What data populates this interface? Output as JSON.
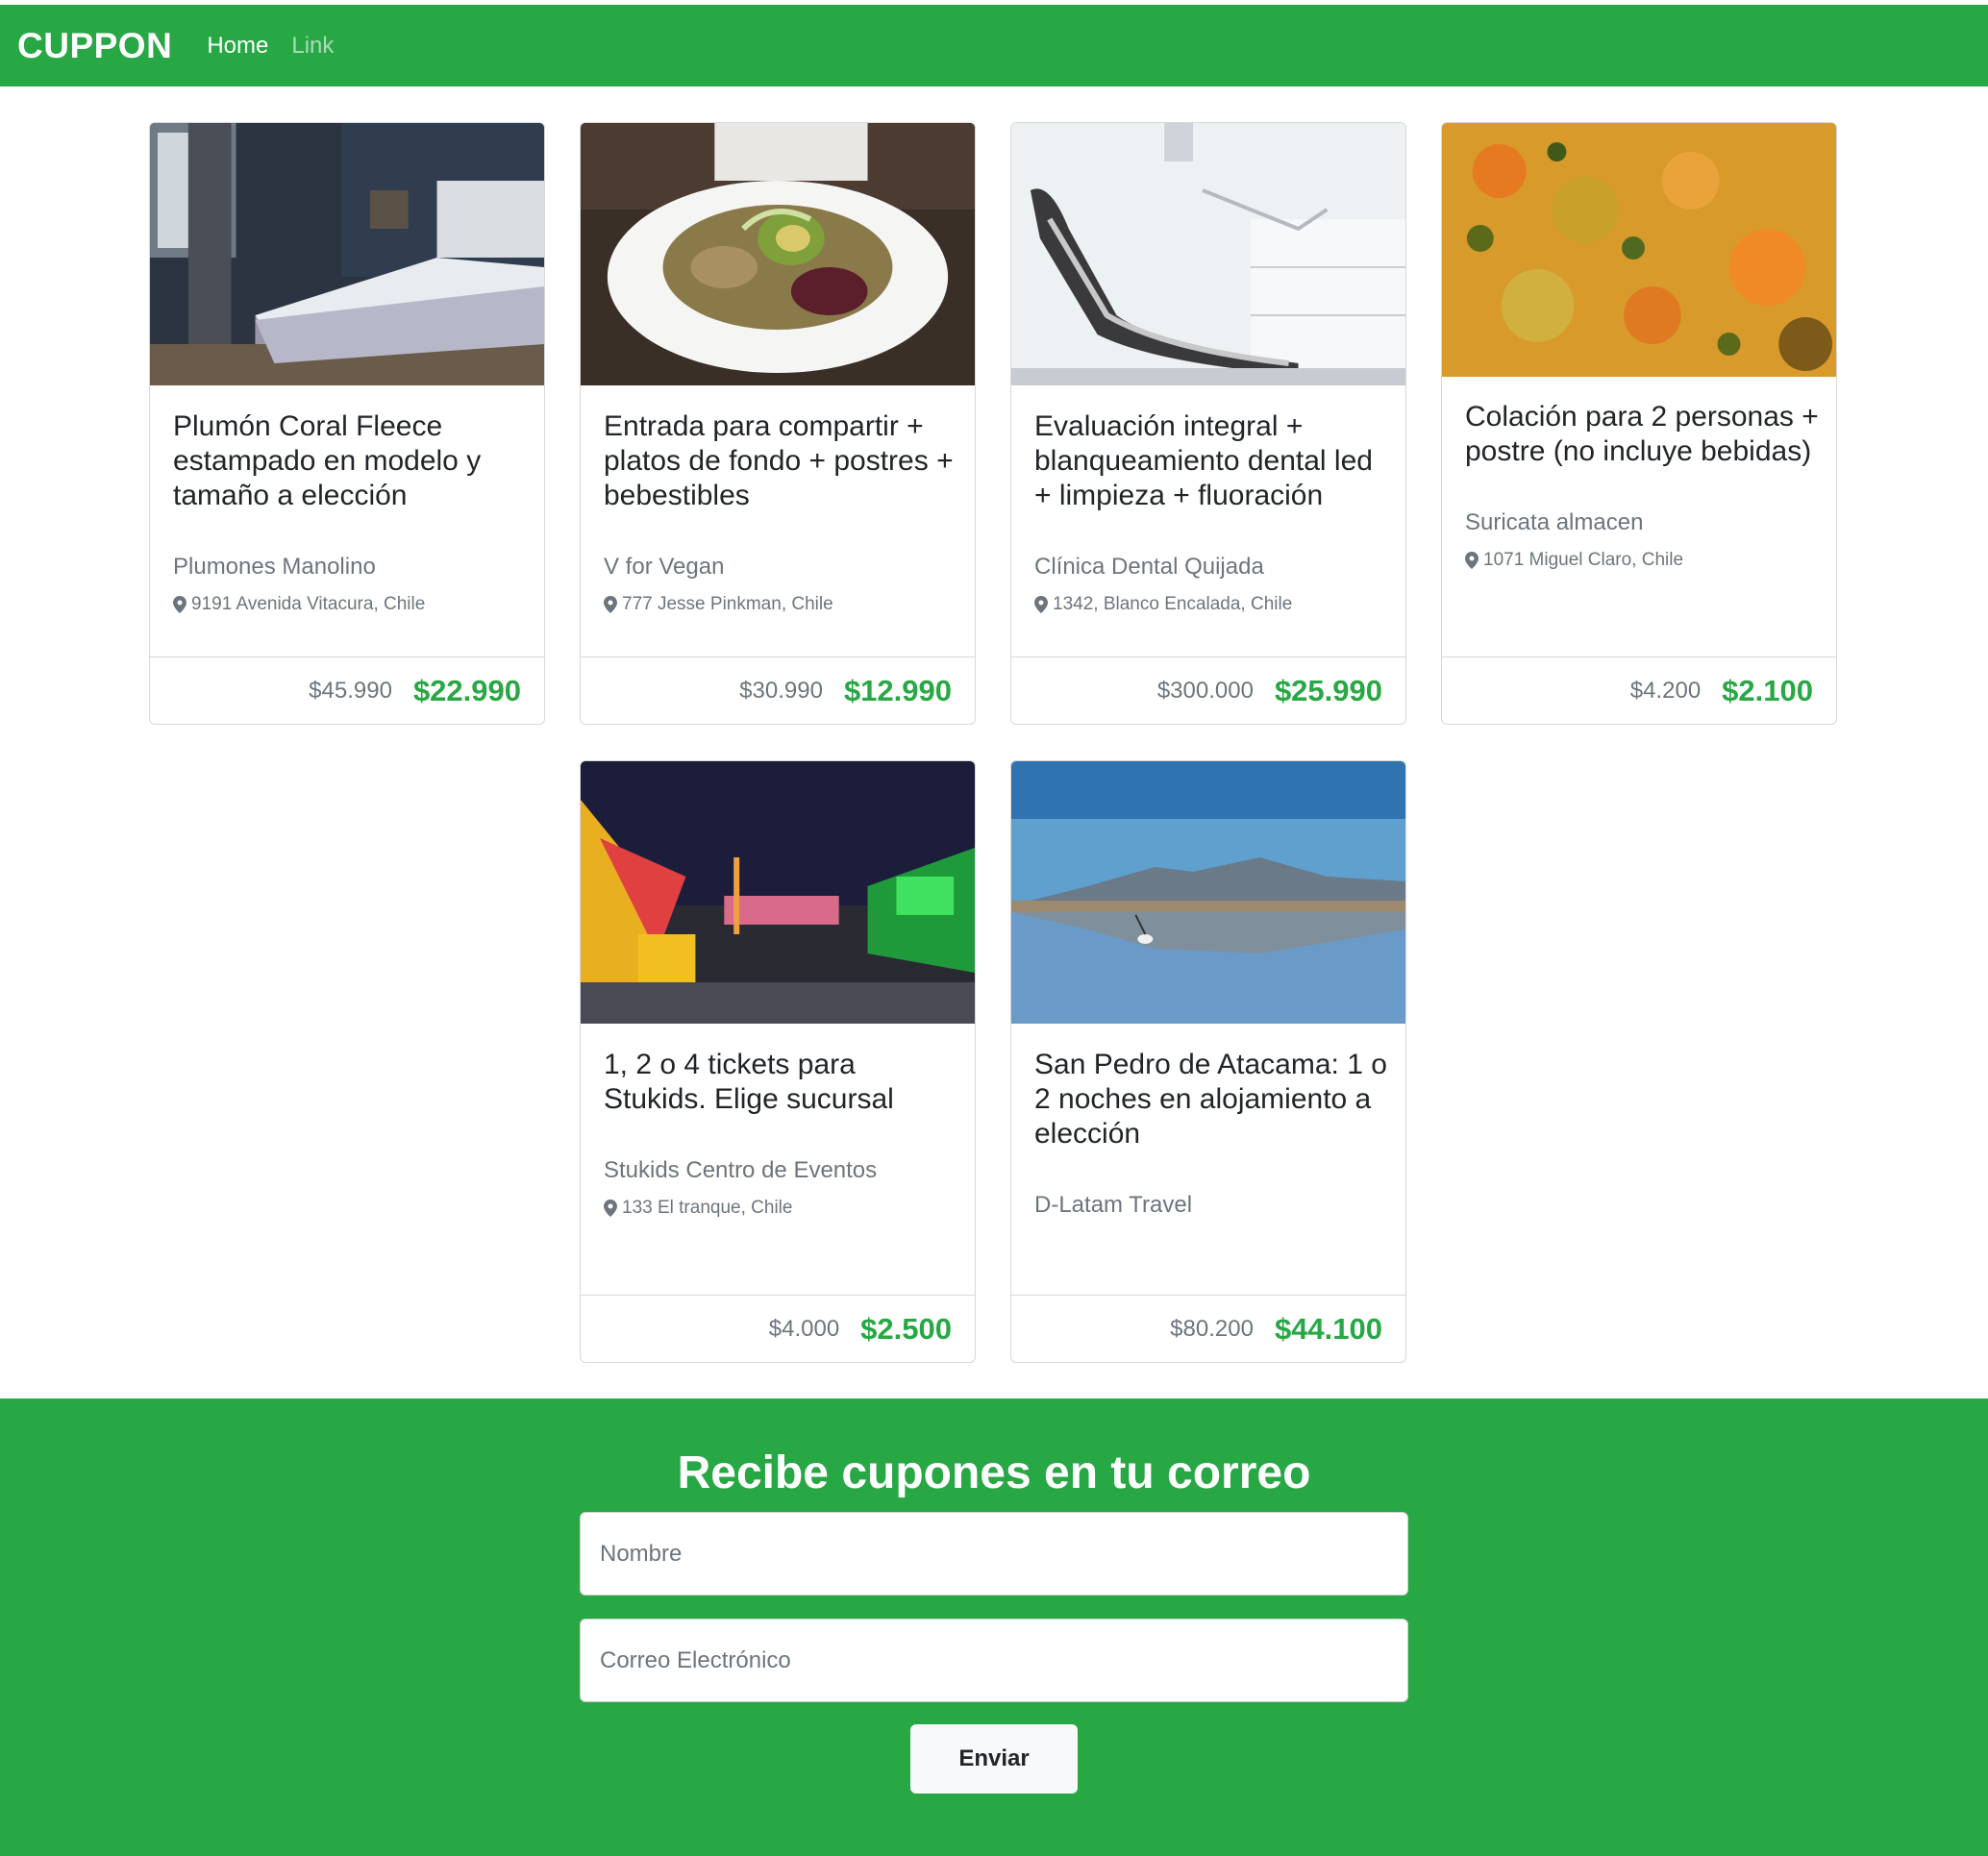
{
  "navbar": {
    "brand": "CUPPON",
    "links": [
      {
        "label": "Home"
      },
      {
        "label": "Link"
      }
    ],
    "color": "#28a745"
  },
  "deals": [
    {
      "title": "Plumón Coral Fleece estampado en modelo y tamaño a elección",
      "merchant": "Plumones Manolino",
      "address": "9191 Avenida Vitacura, Chile",
      "old_price": "$45.990",
      "new_price": "$22.990"
    },
    {
      "title": "Entrada para compartir + platos de fondo + postres + bebestibles",
      "merchant": "V for Vegan",
      "address": "777 Jesse Pinkman, Chile",
      "old_price": "$30.990",
      "new_price": "$12.990"
    },
    {
      "title": "Evaluación integral + blanqueamiento dental led + limpieza + fluoración",
      "merchant": "Clínica Dental Quijada",
      "address": "1342, Blanco Encalada, Chile",
      "old_price": "$300.000",
      "new_price": "$25.990"
    },
    {
      "title": "Colación para 2 personas + postre (no incluye bebidas)",
      "merchant": "Suricata almacen",
      "address": "1071 Miguel Claro, Chile",
      "old_price": "$4.200",
      "new_price": "$2.100"
    },
    {
      "title": "1, 2 o 4 tickets para Stukids. Elige sucursal",
      "merchant": "Stukids Centro de Eventos",
      "address": "133 El tranque, Chile",
      "old_price": "$4.000",
      "new_price": "$2.500"
    },
    {
      "title": "San Pedro de Atacama: 1 o 2 noches en alojamiento a elección",
      "merchant": "D-Latam Travel",
      "address": "",
      "old_price": "$80.200",
      "new_price": "$44.100"
    }
  ],
  "newsletter": {
    "title": "Recibe cupones en tu correo",
    "name_placeholder": "Nombre",
    "email_placeholder": "Correo Electrónico",
    "submit_label": "Enviar"
  }
}
